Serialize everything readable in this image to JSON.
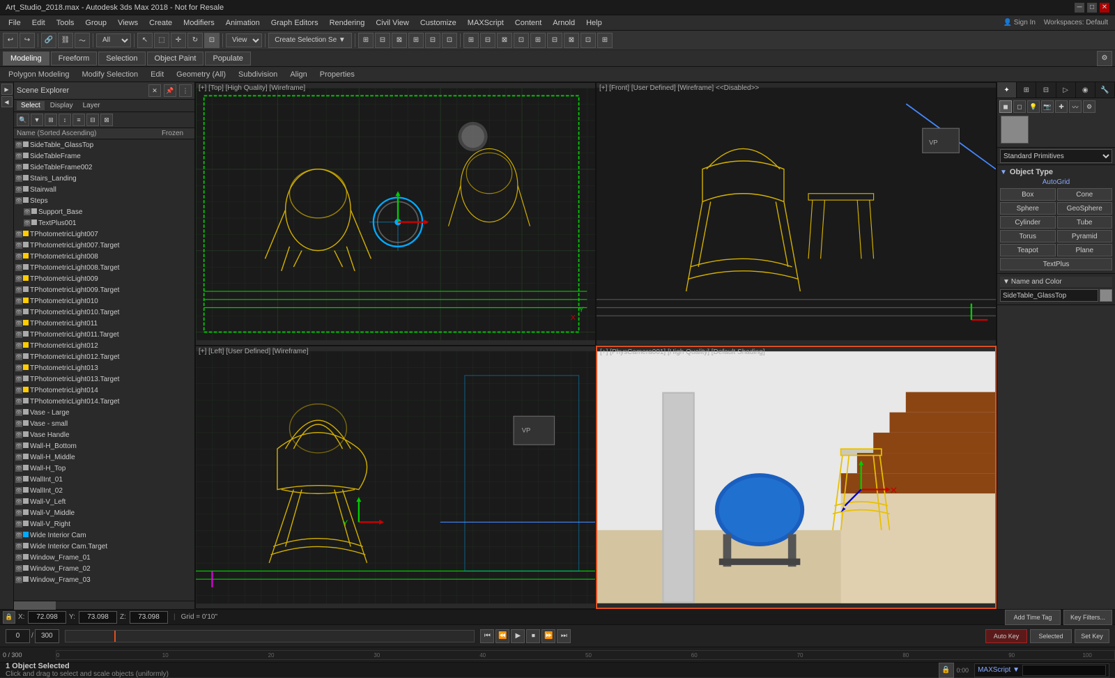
{
  "titlebar": {
    "title": "Art_Studio_2018.max - Autodesk 3ds Max 2018 - Not for Resale",
    "min_label": "─",
    "max_label": "□",
    "close_label": "✕"
  },
  "menubar": {
    "items": [
      "File",
      "Edit",
      "Tools",
      "Group",
      "Views",
      "Create",
      "Modifiers",
      "Animation",
      "Graph Editors",
      "Rendering",
      "Civil View",
      "Customize",
      "MAXScript",
      "Content",
      "Arnold",
      "Help"
    ]
  },
  "toolbar": {
    "workspace_label": "Workspaces: Default",
    "signin_label": "Sign In",
    "view_label": "View",
    "create_selection_label": "Create Selection Se ▼"
  },
  "tabs": {
    "modeling": "Modeling",
    "freeform": "Freeform",
    "selection": "Selection",
    "object_paint": "Object Paint",
    "populate": "Populate"
  },
  "subtabs": {
    "polygon_modeling": "Polygon Modeling",
    "modify_selection": "Modify Selection",
    "edit": "Edit",
    "geometry_all": "Geometry (All)",
    "subdivision": "Subdivision",
    "align": "Align",
    "properties": "Properties"
  },
  "scene_explorer": {
    "title": "Scene",
    "tabs": [
      "Select",
      "Display",
      "Layer"
    ],
    "columns": {
      "name": "Name (Sorted Ascending)",
      "frozen": "Frozen"
    },
    "items": [
      {
        "name": "SideTable_GlassTop",
        "depth": 1,
        "selected": false,
        "type": "geo"
      },
      {
        "name": "SideTableFrame",
        "depth": 1,
        "selected": false,
        "type": "geo"
      },
      {
        "name": "SideTableFrame002",
        "depth": 1,
        "selected": false,
        "type": "geo"
      },
      {
        "name": "Stairs_Landing",
        "depth": 1,
        "selected": false,
        "type": "geo"
      },
      {
        "name": "Stairwall",
        "depth": 1,
        "selected": false,
        "type": "geo"
      },
      {
        "name": "Steps",
        "depth": 1,
        "selected": false,
        "type": "geo"
      },
      {
        "name": "Support_Base",
        "depth": 2,
        "selected": false,
        "type": "geo"
      },
      {
        "name": "TextPlus001",
        "depth": 2,
        "selected": false,
        "type": "txt"
      },
      {
        "name": "TPhotometricLight007",
        "depth": 1,
        "selected": false,
        "type": "lgt"
      },
      {
        "name": "TPhotometricLight007.Target",
        "depth": 1,
        "selected": false,
        "type": "tgt"
      },
      {
        "name": "TPhotometricLight008",
        "depth": 1,
        "selected": false,
        "type": "lgt"
      },
      {
        "name": "TPhotometricLight008.Target",
        "depth": 1,
        "selected": false,
        "type": "tgt"
      },
      {
        "name": "TPhotometricLight009",
        "depth": 1,
        "selected": false,
        "type": "lgt"
      },
      {
        "name": "TPhotometricLight009.Target",
        "depth": 1,
        "selected": false,
        "type": "tgt"
      },
      {
        "name": "TPhotometricLight010",
        "depth": 1,
        "selected": false,
        "type": "lgt"
      },
      {
        "name": "TPhotometricLight010.Target",
        "depth": 1,
        "selected": false,
        "type": "tgt"
      },
      {
        "name": "TPhotometricLight011",
        "depth": 1,
        "selected": false,
        "type": "lgt"
      },
      {
        "name": "TPhotometricLight011.Target",
        "depth": 1,
        "selected": false,
        "type": "tgt"
      },
      {
        "name": "TPhotometricLight012",
        "depth": 1,
        "selected": false,
        "type": "lgt"
      },
      {
        "name": "TPhotometricLight012.Target",
        "depth": 1,
        "selected": false,
        "type": "tgt"
      },
      {
        "name": "TPhotometricLight013",
        "depth": 1,
        "selected": false,
        "type": "lgt"
      },
      {
        "name": "TPhotometricLight013.Target",
        "depth": 1,
        "selected": false,
        "type": "tgt"
      },
      {
        "name": "TPhotometricLight014",
        "depth": 1,
        "selected": false,
        "type": "lgt"
      },
      {
        "name": "TPhotometricLight014.Target",
        "depth": 1,
        "selected": false,
        "type": "tgt"
      },
      {
        "name": "Vase - Large",
        "depth": 1,
        "selected": false,
        "type": "geo"
      },
      {
        "name": "Vase - small",
        "depth": 1,
        "selected": false,
        "type": "geo"
      },
      {
        "name": "Vase Handle",
        "depth": 1,
        "selected": false,
        "type": "geo"
      },
      {
        "name": "Wall-H_Bottom",
        "depth": 1,
        "selected": false,
        "type": "geo"
      },
      {
        "name": "Wall-H_Middle",
        "depth": 1,
        "selected": false,
        "type": "geo"
      },
      {
        "name": "Wall-H_Top",
        "depth": 1,
        "selected": false,
        "type": "geo"
      },
      {
        "name": "WallInt_01",
        "depth": 1,
        "selected": false,
        "type": "geo"
      },
      {
        "name": "WallInt_02",
        "depth": 1,
        "selected": false,
        "type": "geo"
      },
      {
        "name": "Wall-V_Left",
        "depth": 1,
        "selected": false,
        "type": "geo"
      },
      {
        "name": "Wall-V_Middle",
        "depth": 1,
        "selected": false,
        "type": "geo"
      },
      {
        "name": "Wall-V_Right",
        "depth": 1,
        "selected": false,
        "type": "geo"
      },
      {
        "name": "Wide Interior Cam",
        "depth": 1,
        "selected": false,
        "type": "cam"
      },
      {
        "name": "Wide Interior Cam.Target",
        "depth": 1,
        "selected": false,
        "type": "tgt"
      },
      {
        "name": "Window_Frame_01",
        "depth": 1,
        "selected": false,
        "type": "geo"
      },
      {
        "name": "Window_Frame_02",
        "depth": 1,
        "selected": false,
        "type": "geo"
      },
      {
        "name": "Window_Frame_03",
        "depth": 1,
        "selected": false,
        "type": "geo"
      }
    ]
  },
  "viewports": {
    "top_left": {
      "label": "[+] [Top] [High Quality] [Wireframe]"
    },
    "top_right": {
      "label": "[+] [Front] [User Defined] [Wireframe]  <<Disabled>>"
    },
    "bottom_left": {
      "label": "[+] [Left] [User Defined] [Wireframe]"
    },
    "bottom_right": {
      "label": "[+] [PhysCamera001] [High Quality] [Default Shading]"
    }
  },
  "right_panel": {
    "title": "Standard Primitives",
    "object_type_label": "Object Type",
    "autogrid_label": "AutoGrid",
    "buttons": [
      "Box",
      "Cone",
      "Sphere",
      "GeoSphere",
      "Cylinder",
      "Tube",
      "Torus",
      "Pyramid",
      "Teapot",
      "Plane",
      "TextPlus"
    ],
    "name_color_title": "Name and Color",
    "name_value": "SideTable_GlassTop",
    "color": "#888888"
  },
  "status": {
    "selected_label": "1 Object Selected",
    "hint": "Click and drag to select and scale objects (uniformly)"
  },
  "coords": {
    "x_label": "X:",
    "x_value": "72.098",
    "y_label": "Y:",
    "y_value": "73.098",
    "z_label": "Z:",
    "z_value": "73.098",
    "grid_label": "Grid = 0'10\"",
    "time_tag_label": "Add Time Tag"
  },
  "anim": {
    "frame_label": "0 / 300",
    "auto_key": "Auto Key",
    "selected_label": "Selected",
    "set_key": "Set Key",
    "key_filters": "Key Filters...",
    "default_label": "Default"
  },
  "script_bar": {
    "label": "MAXScript",
    "placeholder": ""
  },
  "timeline_numbers": [
    "0",
    "10",
    "20",
    "30",
    "40",
    "50",
    "60",
    "70",
    "80",
    "90",
    "100"
  ]
}
